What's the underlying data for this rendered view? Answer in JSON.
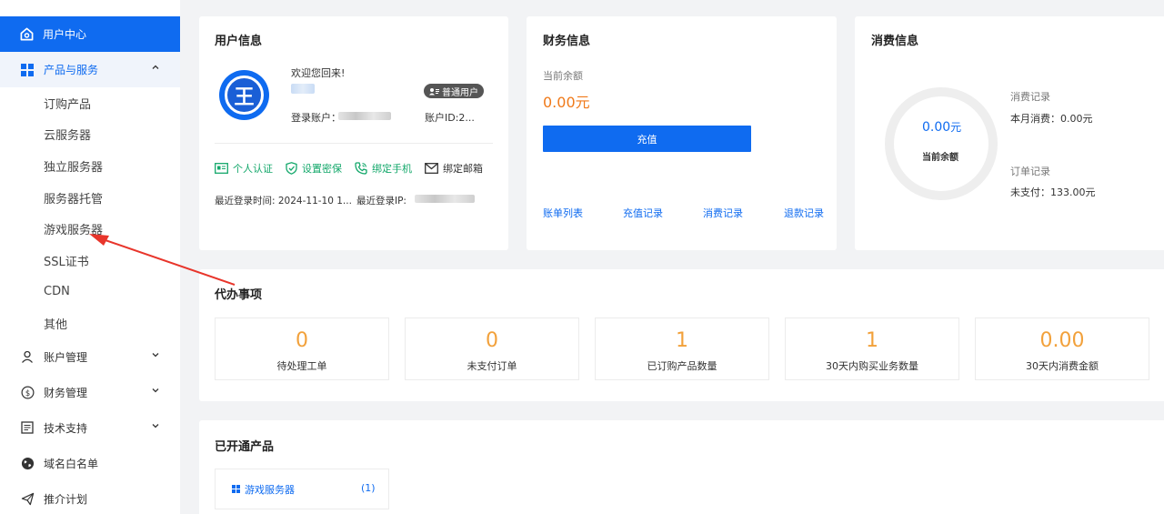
{
  "sidebar": {
    "active_item": "用户中心",
    "products_menu": "产品与服务",
    "sub_items": [
      "订购产品",
      "云服务器",
      "独立服务器",
      "服务器托管",
      "游戏服务器",
      "SSL证书",
      "CDN",
      "其他"
    ],
    "account_menu": "账户管理",
    "finance_menu": "财务管理",
    "support_menu": "技术支持",
    "whitelist_item": "域名白名单",
    "referral_item": "推介计划"
  },
  "user_info": {
    "title": "用户信息",
    "avatar_letter": "王",
    "welcome": "欢迎您回来!",
    "badge": "普通用户",
    "login_account_label": "登录账户：",
    "account_id": "账户ID:2...",
    "actions": {
      "verify": "个人认证",
      "security": "设置密保",
      "phone": "绑定手机",
      "email": "绑定邮箱"
    },
    "last_login_time": "最近登录时间:  2024-11-10 1...",
    "last_login_ip_label": "最近登录IP:"
  },
  "finance_info": {
    "title": "财务信息",
    "balance_label": "当前余额",
    "balance_value": "0.00元",
    "recharge_button": "充值",
    "links": [
      "账单列表",
      "充值记录",
      "消费记录",
      "退款记录"
    ]
  },
  "consumption_info": {
    "title": "消费信息",
    "ring_value_num": "0.00",
    "ring_value_unit": "元",
    "ring_label": "当前余额",
    "consume_record_title": "消费记录",
    "consume_record_value": "本月消费：0.00元",
    "order_record_title": "订单记录",
    "order_record_value": "未支付：133.00元"
  },
  "todo": {
    "title": "代办事项",
    "stats": [
      {
        "value": "0",
        "label": "待处理工单"
      },
      {
        "value": "0",
        "label": "未支付订单"
      },
      {
        "value": "1",
        "label": "已订购产品数量"
      },
      {
        "value": "1",
        "label": "30天内购买业务数量"
      },
      {
        "value": "0.00",
        "label": "30天内消费金额"
      }
    ]
  },
  "products": {
    "title": "已开通产品",
    "item_name": "游戏服务器",
    "item_count": "(1)"
  },
  "colors": {
    "primary": "#0f6bf0",
    "orange": "#f07a1a",
    "stat_orange": "#f2a13b",
    "green": "#14a86b",
    "annotation_red": "#e8352b"
  }
}
